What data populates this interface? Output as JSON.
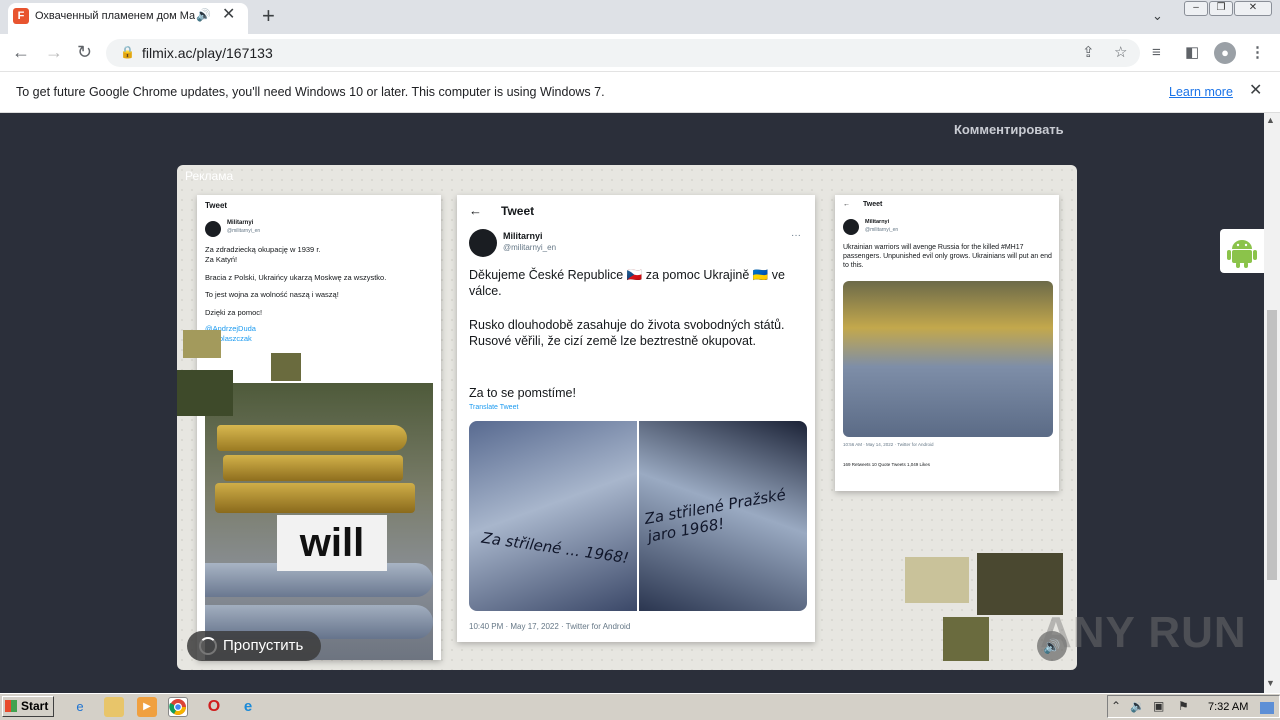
{
  "browser": {
    "tab_title": "Охваченный пламенем дом Ма",
    "tab_favicon_letter": "F",
    "url": "filmix.ac/play/167133"
  },
  "infobar": {
    "message": "To get future Google Chrome updates, you'll need Windows 10 or later. This computer is using Windows 7.",
    "learn_more": "Learn more"
  },
  "page": {
    "comment_link": "Комментировать",
    "ad_label": "Реклама",
    "skip_label": "Пропустить",
    "watermark": "ANY RUN"
  },
  "ad_content": {
    "left_tweet": {
      "header": "Tweet",
      "name": "Militarnyi",
      "handle": "@militarnyi_en",
      "lines": [
        "Za zdradziecką okupację w 1939 r.",
        "Za Katyń!",
        "",
        "Bracia z Polski, Ukraińcy ukarzą Moskwę za wszystko.",
        "",
        "To jest wojna za wolność naszą i waszą!",
        "",
        "Dzięki za pomoc!"
      ],
      "mentions": [
        "@AndrzejDuda",
        "@mblaszczak"
      ],
      "overlay_word": "will"
    },
    "center_tweet": {
      "header": "Tweet",
      "name": "Militarnyi",
      "handle": "@militarnyi_en",
      "line1": "Děkujeme České Republice 🇨🇿 za pomoc Ukrajině 🇺🇦 ve válce.",
      "line2": "Rusko dlouhodobě zasahuje do života svobodných států. Rusové věřili, že cizí země lze beztrestně okupovat.",
      "line3": "Za to se pomstíme!",
      "translate": "Translate Tweet",
      "image_left_text": "Za střilené ... 1968!",
      "image_right_text": "Za střilené Pražské jaro 1968!",
      "footer": "10:40 PM · May 17, 2022 · Twitter for Android"
    },
    "right_tweet": {
      "header": "Tweet",
      "name": "Militarnyi",
      "handle": "@militarnyi_en",
      "text": "Ukrainian warriors will avenge Russia for the killed #MH17 passengers. Unpunished evil only grows. Ukrainians will put an end to this.",
      "meta": "10:56 AM · May 14, 2022 · Twitter for Android",
      "stats": "169 Retweets   10 Quote Tweets   1,049 Likes"
    }
  },
  "taskbar": {
    "start": "Start",
    "clock": "7:32 AM"
  },
  "colors": {
    "page_bg": "#2b2f3a",
    "link": "#1a73e8",
    "camo": "#6a6b3e"
  }
}
